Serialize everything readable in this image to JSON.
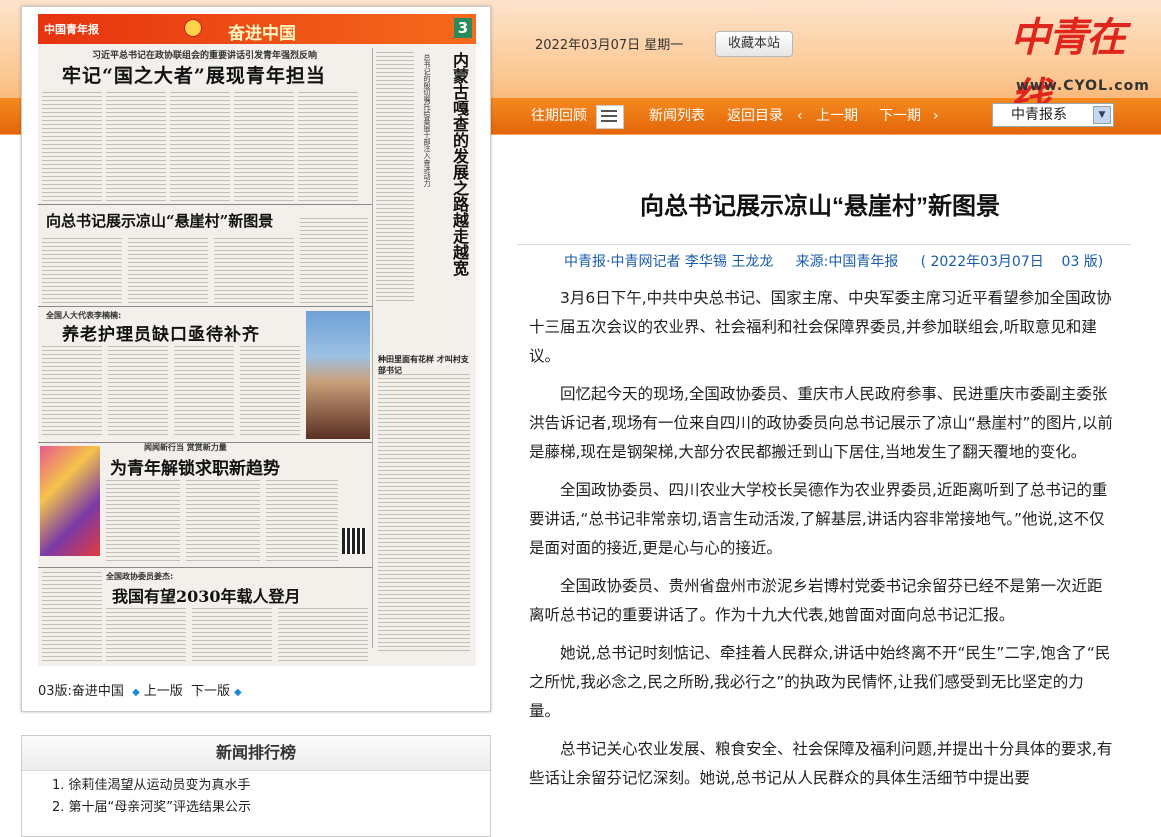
{
  "header": {
    "date": "2022年03月07日 星期一",
    "favorite_label": "收藏本站",
    "brand_cn": "中青在线",
    "brand_url": "www.CYOL.com"
  },
  "nav": {
    "past": "往期回顾",
    "news_list": "新闻列表",
    "back_toc": "返回目录",
    "prev_issue": "上一期",
    "next_issue": "下一期",
    "prev_arrow": "‹",
    "next_arrow": "›",
    "select_value": "中青报系"
  },
  "paper": {
    "masthead": "中国青年报",
    "section": "奋进中国",
    "page_no": "3",
    "sub1": "习近平总书记在政协联组会的重要讲话引发青年强烈反响",
    "h1": "牢记“国之大者”展现青年担当",
    "h2": "向总书记展示凉山“悬崖村”新图景",
    "kick3": "全国人大代表李楠楠:",
    "h3": "养老护理员缺口亟待补齐",
    "kick4": "闻闻新行当 赏赏新力量",
    "h4": "为青年解锁求职新趋势",
    "kick5": "全国政协委员姜杰:",
    "h5": "我国有望2030年载人登月",
    "vert_title": "内蒙古嘎查的发展之路越走越宽",
    "vert_sub": "总书记的殷切嘱托给基层干部注入奋进动力",
    "side_title": "种田里面有花样 才叫村支部书记"
  },
  "paper_nav": {
    "page_label": "03版:奋进中国",
    "prev_page": "上一版",
    "next_page": "下一版"
  },
  "ranking": {
    "title": "新闻排行榜",
    "items": [
      "1. 徐莉佳渴望从运动员变为真水手",
      "2. 第十届“母亲河奖”评选结果公示"
    ]
  },
  "article": {
    "title": "向总书记展示凉山“悬崖村”新图景",
    "meta": "中青报·中青网记者 李华锡 王龙龙     来源:中国青年报     ( 2022年03月07日    03 版)",
    "paragraphs": [
      "3月6日下午,中共中央总书记、国家主席、中央军委主席习近平看望参加全国政协十三届五次会议的农业界、社会福利和社会保障界委员,并参加联组会,听取意见和建议。",
      "回忆起今天的现场,全国政协委员、重庆市人民政府参事、民进重庆市委副主委张洪告诉记者,现场有一位来自四川的政协委员向总书记展示了凉山“悬崖村”的图片,以前是藤梯,现在是钢架梯,大部分农民都搬迁到山下居住,当地发生了翻天覆地的变化。",
      "全国政协委员、四川农业大学校长吴德作为农业界委员,近距离听到了总书记的重要讲话,“总书记非常亲切,语言生动活泼,了解基层,讲话内容非常接地气。”他说,这不仅是面对面的接近,更是心与心的接近。",
      "全国政协委员、贵州省盘州市淤泥乡岩博村党委书记余留芬已经不是第一次近距离听总书记的重要讲话了。作为十九大代表,她曾面对面向总书记汇报。",
      "她说,总书记时刻惦记、牵挂着人民群众,讲话中始终离不开“民生”二字,饱含了“民之所忧,我必念之,民之所盼,我必行之”的执政为民情怀,让我们感受到无比坚定的力量。",
      "总书记关心农业发展、粮食安全、社会保障及福利问题,并提出十分具体的要求,有些话让余留芬记忆深刻。她说,总书记从人民群众的具体生活细节中提出要"
    ]
  }
}
